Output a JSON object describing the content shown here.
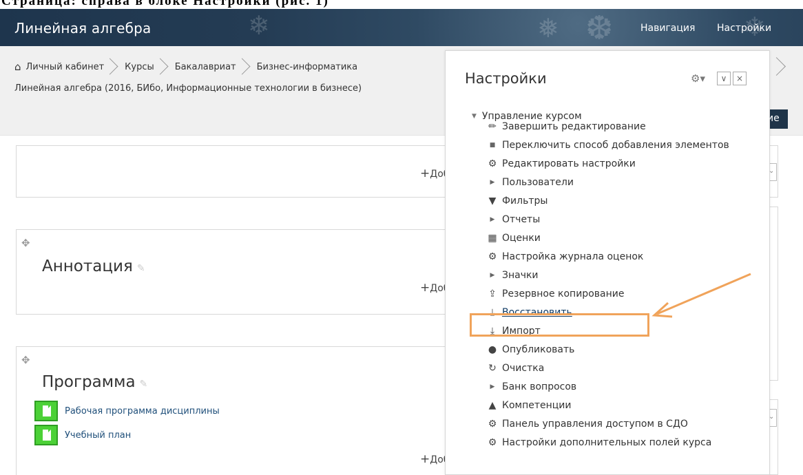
{
  "caption": "Страница: справа в блоке Настройки (рис. 1)",
  "header": {
    "site_title": "Линейная алгебра",
    "nav_navigation": "Навигация",
    "nav_settings": "Настройки"
  },
  "breadcrumb": {
    "items": [
      "Личный кабинет",
      "Курсы",
      "Бакалавриат",
      "Бизнес-информатика"
    ],
    "line2": "Линейная алгебра (2016, БИбо, Информационные технологии в бизнесе)"
  },
  "dark_button_text": "ие",
  "sections": [
    {
      "add_label": "Добав"
    },
    {
      "title": "Аннотация",
      "add_label": "Добав"
    },
    {
      "title": "Программа",
      "add_label": "Добав",
      "resources": [
        "Рабочая программа дисциплины",
        "Учебный план"
      ]
    }
  ],
  "settings_panel": {
    "title": "Настройки",
    "root": "Управление курсом",
    "items": [
      {
        "label": "Завершить редактирование",
        "icon": "pencil-icon"
      },
      {
        "label": "Переключить способ добавления элементов",
        "icon": "square-bullet-icon"
      },
      {
        "label": "Редактировать настройки",
        "icon": "gear-icon"
      },
      {
        "label": "Пользователи",
        "icon": "triangle-right-icon"
      },
      {
        "label": "Фильтры",
        "icon": "filter-icon"
      },
      {
        "label": "Отчеты",
        "icon": "triangle-right-icon"
      },
      {
        "label": "Оценки",
        "icon": "table-icon"
      },
      {
        "label": "Настройка журнала оценок",
        "icon": "gear-icon"
      },
      {
        "label": "Значки",
        "icon": "triangle-right-icon"
      },
      {
        "label": "Резервное копирование",
        "icon": "upload-icon"
      },
      {
        "label": "Восстановить",
        "icon": "download-icon",
        "highlighted": true
      },
      {
        "label": "Импорт",
        "icon": "download-icon"
      },
      {
        "label": "Опубликовать",
        "icon": "globe-icon"
      },
      {
        "label": "Очистка",
        "icon": "refresh-icon"
      },
      {
        "label": "Банк вопросов",
        "icon": "triangle-right-icon"
      },
      {
        "label": "Компетенции",
        "icon": "competency-icon"
      },
      {
        "label": "Панель управления доступом в СДО",
        "icon": "gear-icon"
      },
      {
        "label": "Настройки дополнительных полей курса",
        "icon": "gear-icon"
      }
    ]
  },
  "colors": {
    "header_bg": "#243c54",
    "highlight": "#f0a35a",
    "link": "#0f3a63",
    "resource_icon": "#4cd137"
  }
}
